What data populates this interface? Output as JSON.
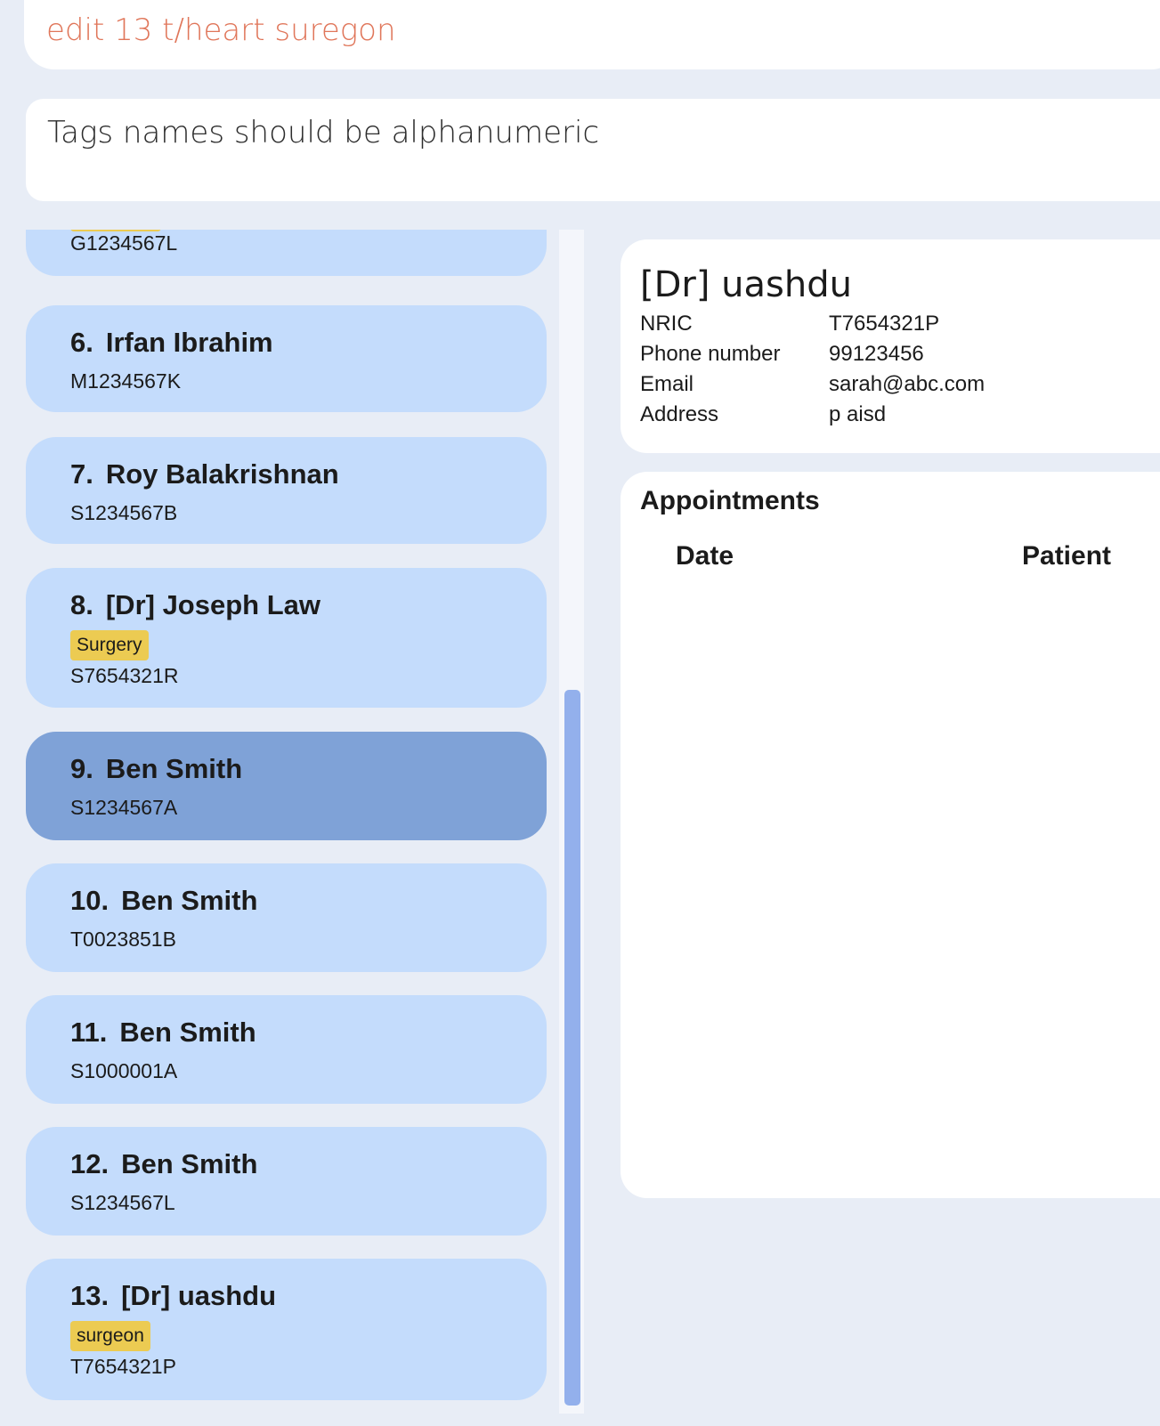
{
  "command": {
    "value": "edit 13 t/heart suregon"
  },
  "result": {
    "message": "Tags names should be alphanumeric"
  },
  "person_list": [
    {
      "index": "",
      "name": "",
      "nric": "G1234567L",
      "tag": ""
    },
    {
      "index": "6.",
      "name": "Irfan Ibrahim",
      "nric": "M1234567K",
      "tag": ""
    },
    {
      "index": "7.",
      "name": "Roy Balakrishnan",
      "nric": "S1234567B",
      "tag": ""
    },
    {
      "index": "8.",
      "name": "[Dr] Joseph Law",
      "nric": "S7654321R",
      "tag": "Surgery"
    },
    {
      "index": "9.",
      "name": "Ben Smith",
      "nric": "S1234567A",
      "tag": "",
      "selected": true
    },
    {
      "index": "10.",
      "name": "Ben Smith",
      "nric": "T0023851B",
      "tag": ""
    },
    {
      "index": "11.",
      "name": "Ben Smith",
      "nric": "S1000001A",
      "tag": ""
    },
    {
      "index": "12.",
      "name": "Ben Smith",
      "nric": "S1234567L",
      "tag": ""
    },
    {
      "index": "13.",
      "name": "[Dr] uashdu",
      "nric": "T7654321P",
      "tag": "surgeon"
    }
  ],
  "detail": {
    "name": "[Dr] uashdu",
    "fields": [
      {
        "label": "NRIC",
        "value": "T7654321P"
      },
      {
        "label": "Phone number",
        "value": "99123456"
      },
      {
        "label": "Email",
        "value": "sarah@abc.com"
      },
      {
        "label": "Address",
        "value": "p aisd"
      }
    ]
  },
  "appointments": {
    "title": "Appointments",
    "columns": [
      "Date",
      "Patient"
    ]
  },
  "colors": {
    "card": "#c4dcfc",
    "card_selected": "#7fa2d7",
    "tag": "#eccb52",
    "command_text": "#e0765a",
    "background": "#e8edf6"
  }
}
